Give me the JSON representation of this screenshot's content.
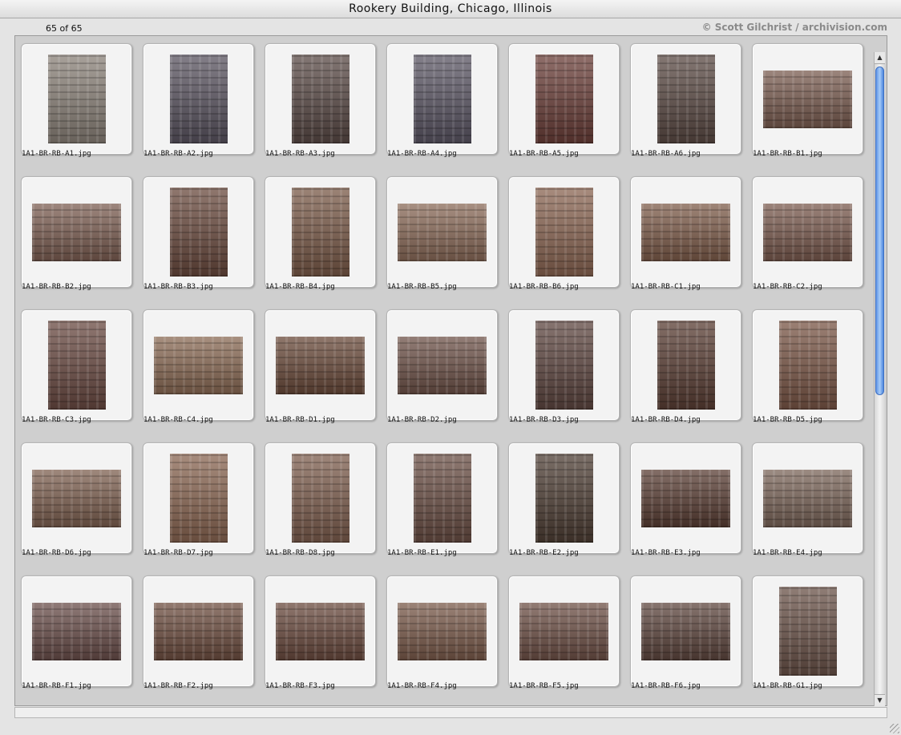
{
  "window": {
    "title": "Rookery Building, Chicago, Illinois"
  },
  "header": {
    "count": "65 of 65",
    "credit": "© Scott Gilchrist / archivision.com"
  },
  "colors": {
    "scroll_accent": "#5f94e6",
    "panel_bg": "#cfcfcf"
  },
  "scroll": {
    "position_fraction": 0.0,
    "visible_fraction": 0.52
  },
  "icons": {
    "scroll_up": "▲",
    "scroll_down": "▼"
  },
  "images": [
    {
      "file": "1A1-BR-RB-A1.jpg",
      "orientation": "portrait",
      "tone": "#8a8178"
    },
    {
      "file": "1A1-BR-RB-A2.jpg",
      "orientation": "portrait",
      "tone": "#5a5460"
    },
    {
      "file": "1A1-BR-RB-A3.jpg",
      "orientation": "portrait",
      "tone": "#5a4a46"
    },
    {
      "file": "1A1-BR-RB-A4.jpg",
      "orientation": "portrait",
      "tone": "#5b5664"
    },
    {
      "file": "1A1-BR-RB-A5.jpg",
      "orientation": "portrait",
      "tone": "#6a3e38"
    },
    {
      "file": "1A1-BR-RB-A6.jpg",
      "orientation": "portrait",
      "tone": "#5b4a44"
    },
    {
      "file": "1A1-BR-RB-B1.jpg",
      "orientation": "landscape",
      "tone": "#7a5c50"
    },
    {
      "file": "1A1-BR-RB-B2.jpg",
      "orientation": "landscape",
      "tone": "#7c5e52"
    },
    {
      "file": "1A1-BR-RB-B3.jpg",
      "orientation": "portrait",
      "tone": "#6a4a3e"
    },
    {
      "file": "1A1-BR-RB-B4.jpg",
      "orientation": "portrait",
      "tone": "#7a5a48"
    },
    {
      "file": "1A1-BR-RB-B5.jpg",
      "orientation": "landscape",
      "tone": "#8a6a58"
    },
    {
      "file": "1A1-BR-RB-B6.jpg",
      "orientation": "portrait",
      "tone": "#8a6552"
    },
    {
      "file": "1A1-BR-RB-C1.jpg",
      "orientation": "landscape",
      "tone": "#7e5c4a"
    },
    {
      "file": "1A1-BR-RB-C2.jpg",
      "orientation": "landscape",
      "tone": "#7a5a4e"
    },
    {
      "file": "1A1-BR-RB-C3.jpg",
      "orientation": "portrait",
      "tone": "#6a4a42"
    },
    {
      "file": "1A1-BR-RB-C4.jpg",
      "orientation": "landscape",
      "tone": "#8a6a54"
    },
    {
      "file": "1A1-BR-RB-D1.jpg",
      "orientation": "landscape",
      "tone": "#6a4a3a"
    },
    {
      "file": "1A1-BR-RB-D2.jpg",
      "orientation": "landscape",
      "tone": "#6e5248"
    },
    {
      "file": "1A1-BR-RB-D3.jpg",
      "orientation": "portrait",
      "tone": "#5e4640"
    },
    {
      "file": "1A1-BR-RB-D4.jpg",
      "orientation": "portrait",
      "tone": "#5a3e34"
    },
    {
      "file": "1A1-BR-RB-D5.jpg",
      "orientation": "portrait",
      "tone": "#7a5646"
    },
    {
      "file": "1A1-BR-RB-D6.jpg",
      "orientation": "landscape",
      "tone": "#7e6050"
    },
    {
      "file": "1A1-BR-RB-D7.jpg",
      "orientation": "portrait",
      "tone": "#8a6652"
    },
    {
      "file": "1A1-BR-RB-D8.jpg",
      "orientation": "portrait",
      "tone": "#7e5e4e"
    },
    {
      "file": "1A1-BR-RB-E1.jpg",
      "orientation": "portrait",
      "tone": "#6a4e44"
    },
    {
      "file": "1A1-BR-RB-E2.jpg",
      "orientation": "portrait",
      "tone": "#4e3e34"
    },
    {
      "file": "1A1-BR-RB-E3.jpg",
      "orientation": "landscape",
      "tone": "#5a3e34"
    },
    {
      "file": "1A1-BR-RB-E4.jpg",
      "orientation": "landscape",
      "tone": "#7a6458"
    },
    {
      "file": "1A1-BR-RB-F1.jpg",
      "orientation": "landscape",
      "tone": "#6a4e4a"
    },
    {
      "file": "1A1-BR-RB-F2.jpg",
      "orientation": "landscape",
      "tone": "#6e4e40"
    },
    {
      "file": "1A1-BR-RB-F3.jpg",
      "orientation": "landscape",
      "tone": "#6a4a3e"
    },
    {
      "file": "1A1-BR-RB-F4.jpg",
      "orientation": "landscape",
      "tone": "#7a5a4a"
    },
    {
      "file": "1A1-BR-RB-F5.jpg",
      "orientation": "landscape",
      "tone": "#6e5046"
    },
    {
      "file": "1A1-BR-RB-F6.jpg",
      "orientation": "landscape",
      "tone": "#5e463e"
    },
    {
      "file": "1A1-BR-RB-G1.jpg",
      "orientation": "portrait",
      "tone": "#6a5248"
    }
  ]
}
